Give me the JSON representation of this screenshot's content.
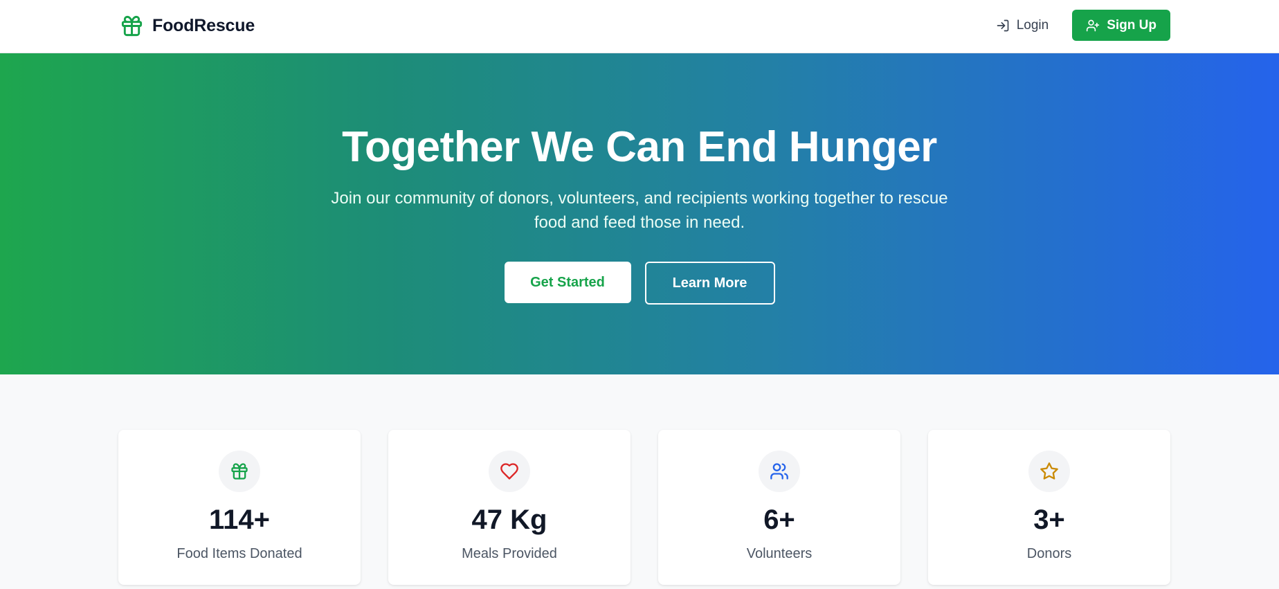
{
  "header": {
    "brand_name": "FoodRescue",
    "brand_icon": "gift-icon",
    "login_label": "Login",
    "login_icon": "log-in-icon",
    "signup_label": "Sign Up",
    "signup_icon": "user-plus-icon"
  },
  "hero": {
    "title": "Together We Can End Hunger",
    "subtitle": "Join our community of donors, volunteers, and recipients working together to rescue food and feed those in need.",
    "primary_cta": "Get Started",
    "secondary_cta": "Learn More"
  },
  "stats": [
    {
      "icon": "gift-icon",
      "value": "114+",
      "label": "Food Items Donated",
      "color": "#16a34a"
    },
    {
      "icon": "heart-icon",
      "value": "47 Kg",
      "label": "Meals Provided",
      "color": "#dc2626"
    },
    {
      "icon": "users-icon",
      "value": "6+",
      "label": "Volunteers",
      "color": "#2563eb"
    },
    {
      "icon": "star-icon",
      "value": "3+",
      "label": "Donors",
      "color": "#ca8a04"
    }
  ],
  "colors": {
    "brand_green": "#16a34a",
    "hero_gradient_start": "#1ea64e",
    "hero_gradient_end": "#2563eb",
    "page_background": "#f8f9fa"
  }
}
